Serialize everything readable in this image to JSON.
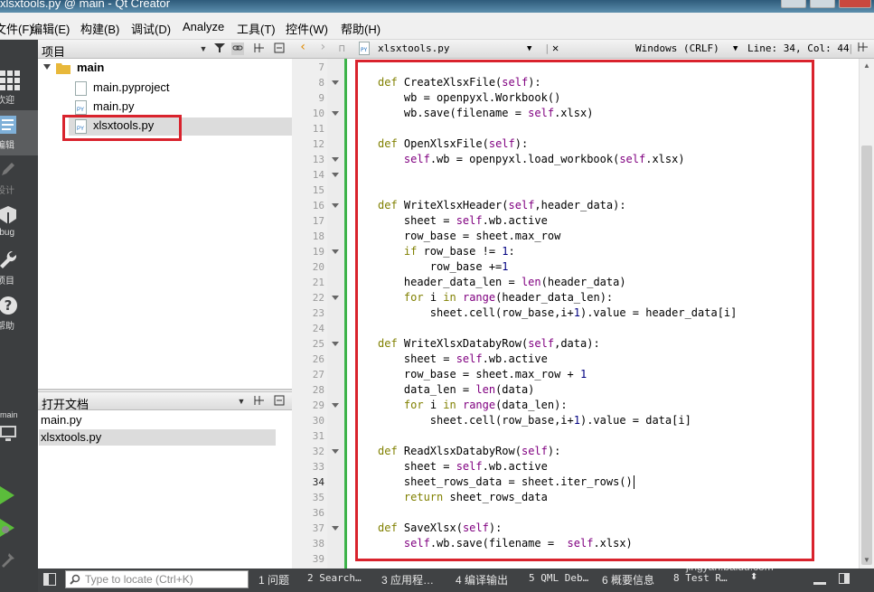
{
  "window": {
    "title": "xlsxtools.py @ main - Qt Creator"
  },
  "menu": [
    "文件(F)",
    "编辑(E)",
    "构建(B)",
    "调试(D)",
    "Analyze",
    "工具(T)",
    "控件(W)",
    "帮助(H)"
  ],
  "modes": [
    {
      "label": "欢迎",
      "icon": "grid-icon"
    },
    {
      "label": "编辑",
      "icon": "edit-icon"
    },
    {
      "label": "设计",
      "icon": "pencil-icon"
    },
    {
      "label": "Debug",
      "icon": "bug-icon"
    },
    {
      "label": "项目",
      "icon": "wrench-icon"
    },
    {
      "label": "帮助",
      "icon": "help-icon"
    }
  ],
  "target": {
    "kit_label": "main"
  },
  "projects": {
    "header": "项目",
    "root": "main",
    "files": [
      "main.pyproject",
      "main.py",
      "xlsxtools.py"
    ]
  },
  "open_docs": {
    "header": "打开文档",
    "files": [
      "main.py",
      "xlsxtools.py"
    ]
  },
  "editor": {
    "filename": "xlsxtools.py",
    "line_ending": "Windows (CRLF)",
    "position": "Line: 34, Col: 44",
    "current_line": 34,
    "lines": [
      {
        "n": 7,
        "text": ""
      },
      {
        "n": 8,
        "text": "def CreateXlsxFile(self):",
        "fold": true
      },
      {
        "n": 9,
        "text": "    wb = openpyxl.Workbook()"
      },
      {
        "n": 10,
        "text": "    wb.save(filename = self.xlsx)",
        "fold": true
      },
      {
        "n": 11,
        "text": ""
      },
      {
        "n": 12,
        "text": "def OpenXlsxFile(self):"
      },
      {
        "n": 13,
        "text": "    self.wb = openpyxl.load_workbook(self.xlsx)",
        "fold": true
      },
      {
        "n": 14,
        "text": "",
        "fold": true
      },
      {
        "n": 15,
        "text": ""
      },
      {
        "n": 16,
        "text": "def WriteXlsxHeader(self,header_data):",
        "fold": true
      },
      {
        "n": 17,
        "text": "    sheet = self.wb.active"
      },
      {
        "n": 18,
        "text": "    row_base = sheet.max_row"
      },
      {
        "n": 19,
        "text": "    if row_base != 1:",
        "fold": true
      },
      {
        "n": 20,
        "text": "        row_base +=1"
      },
      {
        "n": 21,
        "text": "    header_data_len = len(header_data)"
      },
      {
        "n": 22,
        "text": "    for i in range(header_data_len):",
        "fold": true
      },
      {
        "n": 23,
        "text": "        sheet.cell(row_base,i+1).value = header_data[i]"
      },
      {
        "n": 24,
        "text": ""
      },
      {
        "n": 25,
        "text": "def WriteXlsxDatabyRow(self,data):",
        "fold": true
      },
      {
        "n": 26,
        "text": "    sheet = self.wb.active"
      },
      {
        "n": 27,
        "text": "    row_base = sheet.max_row + 1"
      },
      {
        "n": 28,
        "text": "    data_len = len(data)"
      },
      {
        "n": 29,
        "text": "    for i in range(data_len):",
        "fold": true
      },
      {
        "n": 30,
        "text": "        sheet.cell(row_base,i+1).value = data[i]"
      },
      {
        "n": 31,
        "text": ""
      },
      {
        "n": 32,
        "text": "def ReadXlsxDatabyRow(self):",
        "fold": true
      },
      {
        "n": 33,
        "text": "    sheet = self.wb.active"
      },
      {
        "n": 34,
        "text": "    sheet_rows_data = sheet.iter_rows()"
      },
      {
        "n": 35,
        "text": "    return sheet_rows_data"
      },
      {
        "n": 36,
        "text": ""
      },
      {
        "n": 37,
        "text": "def SaveXlsx(self):",
        "fold": true
      },
      {
        "n": 38,
        "text": "    self.wb.save(filename =  self.xlsx)"
      },
      {
        "n": 39,
        "text": ""
      }
    ]
  },
  "status": {
    "locate_placeholder": "Type to locate (Ctrl+K)",
    "tabs": [
      "1 问题",
      "2 Search…",
      "3 应用程…",
      "4 编译输出",
      "5 QML Deb…",
      "6 概要信息",
      "8 Test R…"
    ]
  },
  "watermark": {
    "brand": "Bai 经验",
    "url": "jingyan.baidu.com"
  },
  "colors": {
    "keyword": "#808000",
    "self": "#800080",
    "highlight_box": "#d9232d",
    "modebar": "#3c3e40"
  }
}
